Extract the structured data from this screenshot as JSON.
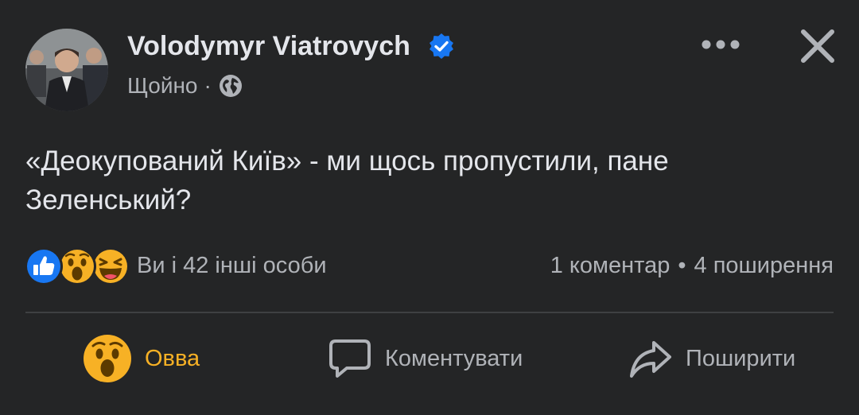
{
  "post": {
    "author": "Volodymyr Viatrovych",
    "time": "Щойно",
    "meta_separator": "·",
    "text": "«Деокупований Київ» - ми щось пропустили, пане Зеленський?"
  },
  "reactions": {
    "icons": [
      "like-icon",
      "wow-icon",
      "haha-icon"
    ],
    "summary": "Ви і 42 інші особи",
    "comments": "1 коментар",
    "separator": "•",
    "shares": "4 поширення"
  },
  "actions": {
    "reaction_label": "Овва",
    "comment_label": "Коментувати",
    "share_label": "Поширити"
  },
  "colors": {
    "background": "#242526",
    "text_primary": "#e4e6eb",
    "text_secondary": "#b0b3b8",
    "verified_blue": "#1877f2",
    "reaction_yellow": "#f7b125",
    "divider": "#3e4042"
  }
}
